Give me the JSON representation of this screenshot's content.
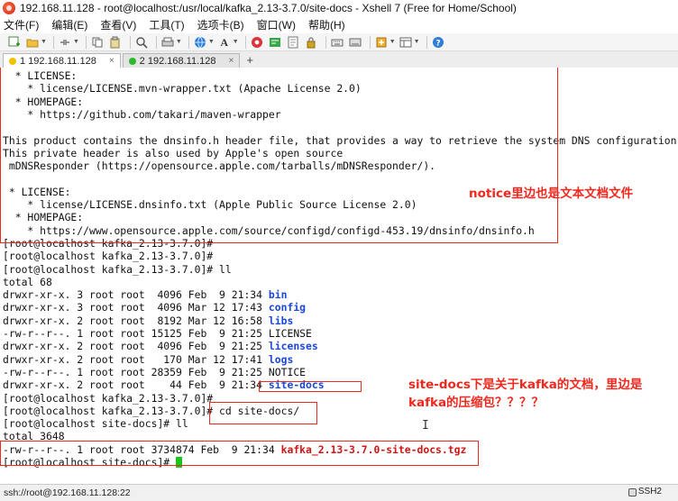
{
  "window": {
    "title": "192.168.11.128 - root@localhost:/usr/local/kafka_2.13-3.7.0/site-docs - Xshell 7 (Free for Home/School)"
  },
  "menu": [
    "文件(F)",
    "编辑(E)",
    "查看(V)",
    "工具(T)",
    "选项卡(B)",
    "窗口(W)",
    "帮助(H)"
  ],
  "tabs": [
    {
      "label": "1 192.168.11.128",
      "status_color": "#f2c200"
    },
    {
      "label": "2 192.168.11.128",
      "status_color": "#2eb82e"
    }
  ],
  "tab_add": "+",
  "tab_close": "×",
  "toolbar_icons": [
    "new-session-icon",
    "open-folder-icon",
    "disconnect-icon",
    "reconnect-icon",
    "copy-icon",
    "paste-icon",
    "find-icon",
    "print-icon",
    "properties-icon",
    "globe-icon",
    "font-icon",
    "xftp-icon",
    "compose-icon",
    "lock-icon",
    "keyboard-icon",
    "transfer-icon",
    "script-icon",
    "layout-icon",
    "help-icon"
  ],
  "terminal_lines": [
    [
      {
        "t": "  * LICENSE:"
      }
    ],
    [
      {
        "t": "    * license/LICENSE.mvn-wrapper.txt (Apache License 2.0)"
      }
    ],
    [
      {
        "t": "  * HOMEPAGE:"
      }
    ],
    [
      {
        "t": "    * https://github.com/takari/maven-wrapper"
      }
    ],
    [
      {
        "t": ""
      }
    ],
    [
      {
        "t": "This product contains the dnsinfo.h header file, that provides a way to retrieve the system DNS configuration on MacOS."
      }
    ],
    [
      {
        "t": "This private header is also used by Apple's open source"
      }
    ],
    [
      {
        "t": " mDNSResponder (https://opensource.apple.com/tarballs/mDNSResponder/)."
      }
    ],
    [
      {
        "t": ""
      }
    ],
    [
      {
        "t": " * LICENSE:"
      }
    ],
    [
      {
        "t": "    * license/LICENSE.dnsinfo.txt (Apple Public Source License 2.0)"
      }
    ],
    [
      {
        "t": "  * HOMEPAGE:"
      }
    ],
    [
      {
        "t": "    * https://www.opensource.apple.com/source/configd/configd-453.19/dnsinfo/dnsinfo.h"
      }
    ],
    [
      {
        "t": "[root@localhost kafka_2.13-3.7.0]#"
      }
    ],
    [
      {
        "t": "[root@localhost kafka_2.13-3.7.0]#"
      }
    ],
    [
      {
        "t": "[root@localhost kafka_2.13-3.7.0]# ll"
      }
    ],
    [
      {
        "t": "total 68"
      }
    ],
    [
      {
        "t": "drwxr-xr-x. 3 root root  4096 Feb  9 21:34 "
      },
      {
        "t": "bin",
        "c": "blue"
      }
    ],
    [
      {
        "t": "drwxr-xr-x. 3 root root  4096 Mar 12 17:43 "
      },
      {
        "t": "config",
        "c": "blue"
      }
    ],
    [
      {
        "t": "drwxr-xr-x. 2 root root  8192 Mar 12 16:58 "
      },
      {
        "t": "libs",
        "c": "blue"
      }
    ],
    [
      {
        "t": "-rw-r--r--. 1 root root 15125 Feb  9 21:25 LICENSE"
      }
    ],
    [
      {
        "t": "drwxr-xr-x. 2 root root  4096 Feb  9 21:25 "
      },
      {
        "t": "licenses",
        "c": "blue"
      }
    ],
    [
      {
        "t": "drwxr-xr-x. 2 root root   170 Mar 12 17:41 "
      },
      {
        "t": "logs",
        "c": "blue"
      }
    ],
    [
      {
        "t": "-rw-r--r--. 1 root root 28359 Feb  9 21:25 NOTICE"
      }
    ],
    [
      {
        "t": "drwxr-xr-x. 2 root root    44 Feb  9 21:34 "
      },
      {
        "t": "site-docs",
        "c": "blue"
      }
    ],
    [
      {
        "t": "[root@localhost kafka_2.13-3.7.0]#"
      }
    ],
    [
      {
        "t": "[root@localhost kafka_2.13-3.7.0]# cd site-docs/"
      }
    ],
    [
      {
        "t": "[root@localhost site-docs]# ll"
      }
    ],
    [
      {
        "t": "total 3648"
      }
    ],
    [
      {
        "t": "-rw-r--r--. 1 root root 3734874 Feb  9 21:34 "
      },
      {
        "t": "kafka_2.13-3.7.0-site-docs.tgz",
        "c": "red"
      }
    ],
    [
      {
        "t": "[root@localhost site-docs]# "
      },
      {
        "t": "",
        "c": "cursor"
      }
    ]
  ],
  "annotations": {
    "notice_note": "notice里边也是文本文档文件",
    "sitedocs_note": "site-docs下是关于kafka的文档，里边是\nkafka的压缩包？？？？",
    "color": "#f0281e"
  },
  "status": {
    "connection": "ssh://root@192.168.11.128:22",
    "protocol": "SSH2"
  }
}
